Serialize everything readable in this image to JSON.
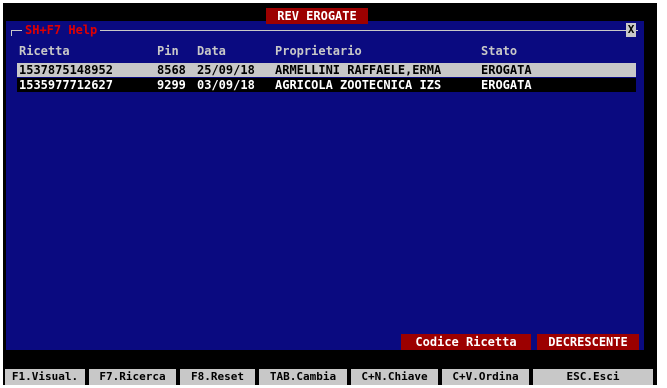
{
  "window": {
    "title": "REV EROGATE",
    "help_label": "SH+F7 Help",
    "close_glyph": "X"
  },
  "table": {
    "headers": [
      "Ricetta",
      "Pin",
      "Data",
      "Proprietario",
      "Stato"
    ],
    "rows": [
      {
        "ricetta": "1537875148952",
        "pin": "8568",
        "data": "25/09/18",
        "proprietario": "ARMELLINI RAFFAELE,ERMA",
        "stato": "EROGATA",
        "selected": true
      },
      {
        "ricetta": "1535977712627",
        "pin": "9299",
        "data": "03/09/18",
        "proprietario": "AGRICOLA ZOOTECNICA IZS",
        "stato": "EROGATA",
        "selected": false
      }
    ]
  },
  "sort": {
    "field": "Codice Ricetta",
    "direction": "DECRESCENTE"
  },
  "function_keys": [
    "F1.Visual.",
    "F7.Ricerca",
    "F8.Reset",
    "TAB.Cambia",
    "C+N.Chiave",
    "C+V.Ordina",
    "ESC.Esci"
  ],
  "colors": {
    "panel_bg": "#0a0a80",
    "title_bg": "#9c0000",
    "highlight": "#c8c8c8",
    "help_text": "#e00000"
  }
}
